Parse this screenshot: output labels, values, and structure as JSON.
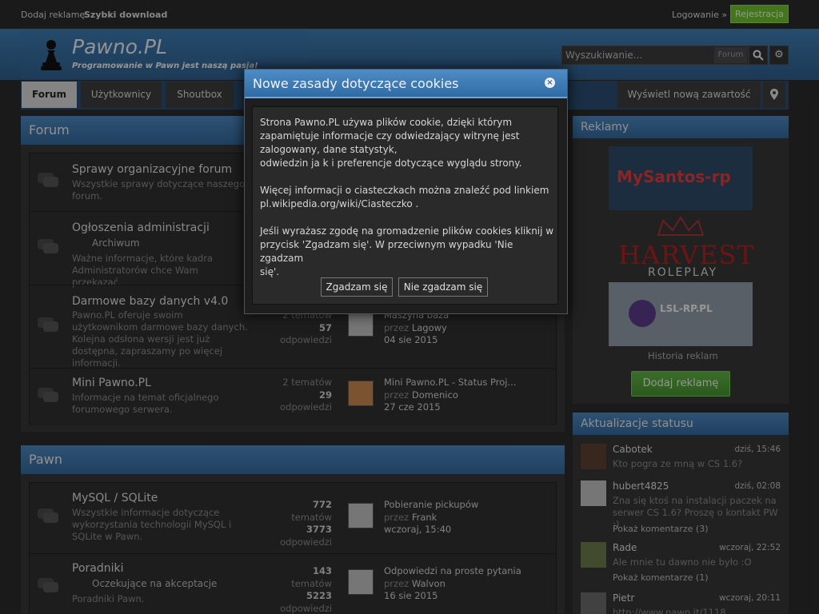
{
  "topbar": {
    "advertise": "Dodaj reklamę",
    "quick_download": "Szybki download",
    "login": "Logowanie »",
    "register": "Rejestracja"
  },
  "header": {
    "logo_text": "Pawno.PL",
    "slogan": "Programowanie w Pawn jest naszą pasją!",
    "search_placeholder": "Wyszukiwanie...",
    "search_scope": "Forum"
  },
  "nav": {
    "tabs": [
      "Forum",
      "Użytkownicy",
      "Shoutbox"
    ],
    "new_content": "Wyświetl nową zawartość"
  },
  "forum_cat": {
    "title": "Forum",
    "rows": [
      {
        "name": "Sprawy organizacyjne forum",
        "desc": "Wszystkie sprawy dotyczące naszego forum."
      },
      {
        "name": "Ogłoszenia administracji",
        "sub": "Archiwum",
        "desc": "Ważne informacje, które kadra Administratorów chce Wam przekazać."
      },
      {
        "name": "Darmowe bazy danych v4.0",
        "desc": "Pawno.PL oferuje swoim użytkownikom darmowe bazy danych. Kolejna odsłona wersji jest już dostępna, zapraszamy po więcej informacji.",
        "topics": "2 tematów",
        "replies": "57",
        "replies_label": "odpowiedzi",
        "last_title": "Maszyna baza",
        "last_by": "przez",
        "last_user": "Lagowy",
        "last_date": "04 sie 2015"
      },
      {
        "name": "Mini Pawno.PL",
        "desc": "Informacje na temat oficjalnego forumowego serwera.",
        "topics": "2 tematów",
        "replies": "29",
        "replies_label": "odpowiedzi",
        "last_title": "Mini Pawno.PL - Status Proj...",
        "last_by": "przez",
        "last_user": "Domenico",
        "last_date": "27 cze 2015"
      }
    ]
  },
  "pawn_cat": {
    "title": "Pawn",
    "rows": [
      {
        "name": "MySQL / SQLite",
        "desc": "Wszystkie informacje dotyczące wykorzystania technologii MySQL i SQLite w Pawn.",
        "topics_num": "772",
        "topics_label": "tematów",
        "replies": "3773",
        "replies_label": "odpowiedzi",
        "last_title": "Pobieranie pickupów",
        "last_by": "przez",
        "last_user": "Frank",
        "last_date": "wczoraj, 15:40"
      },
      {
        "name": "Poradniki",
        "sub": "Oczekujące na akceptacje",
        "desc": "Poradniki Pawn.",
        "topics_num": "143",
        "topics_label": "tematów",
        "replies": "5223",
        "replies_label": "odpowiedzi",
        "last_title": "Odpowiedzi na proste pytania",
        "last_by": "przez",
        "last_user": "Walvon",
        "last_date": "16 sie 2015"
      }
    ]
  },
  "sidebar": {
    "ads_title": "Reklamy",
    "ad1": "MySantos-rp",
    "ad2_line1": "HARVEST",
    "ad2_line2": "ROLEPLAY",
    "ad3": "LSL-RP.PL",
    "ads_history": "Historia reklam",
    "add_ad": "Dodaj reklamę",
    "status_title": "Aktualizacje statusu",
    "statuses": [
      {
        "name": "Cabotek",
        "time": "dziś, 15:46",
        "text": "Kto pogra ze mną w CS 1.6?"
      },
      {
        "name": "hubert4825",
        "time": "dziś, 02:08",
        "text": "Zna się ktoś na instalacji paczek na serwer CS 1.6? Proszę o kontakt PW :)",
        "comments": "Pokaż komentarze (3)"
      },
      {
        "name": "Rade",
        "time": "wczoraj, 22:52",
        "text": "Ale mnie tu dawno nie było :O",
        "comments": "Pokaż komentarze (1)"
      },
      {
        "name": "Pietr",
        "time": "wczoraj, 20:11",
        "text": "http://www.pawn.it/1118"
      }
    ]
  },
  "modal": {
    "title": "Nowe zasady dotyczące cookies",
    "p1": "Strona Pawno.PL używa plików cookie, dzięki którym\nzapamiętuje informacje czy odwiedzający witrynę jest\nzalogowany, dane statystyk,\nodwiedzin ja k i preferencje dotyczące wyglądu strony.",
    "p2": "Więcej informacji o ciasteczkach można znaleźć pod linkiem\npl.wikipedia.org/wiki/Ciasteczko .",
    "p3": "Jeśli wyrażasz zgodę na gromadzenie plików cookies kliknij w\nprzycisk 'Zgadzam się'. W przeciwnym wypadku 'Nie zgadzam\nsię'.",
    "agree": "Zgadzam się",
    "disagree": "Nie zgadzam się"
  },
  "colors": {
    "header_blue": "#3e6f9f",
    "register_green": "#6cbf2a",
    "add_ad_green": "#5fb144"
  }
}
